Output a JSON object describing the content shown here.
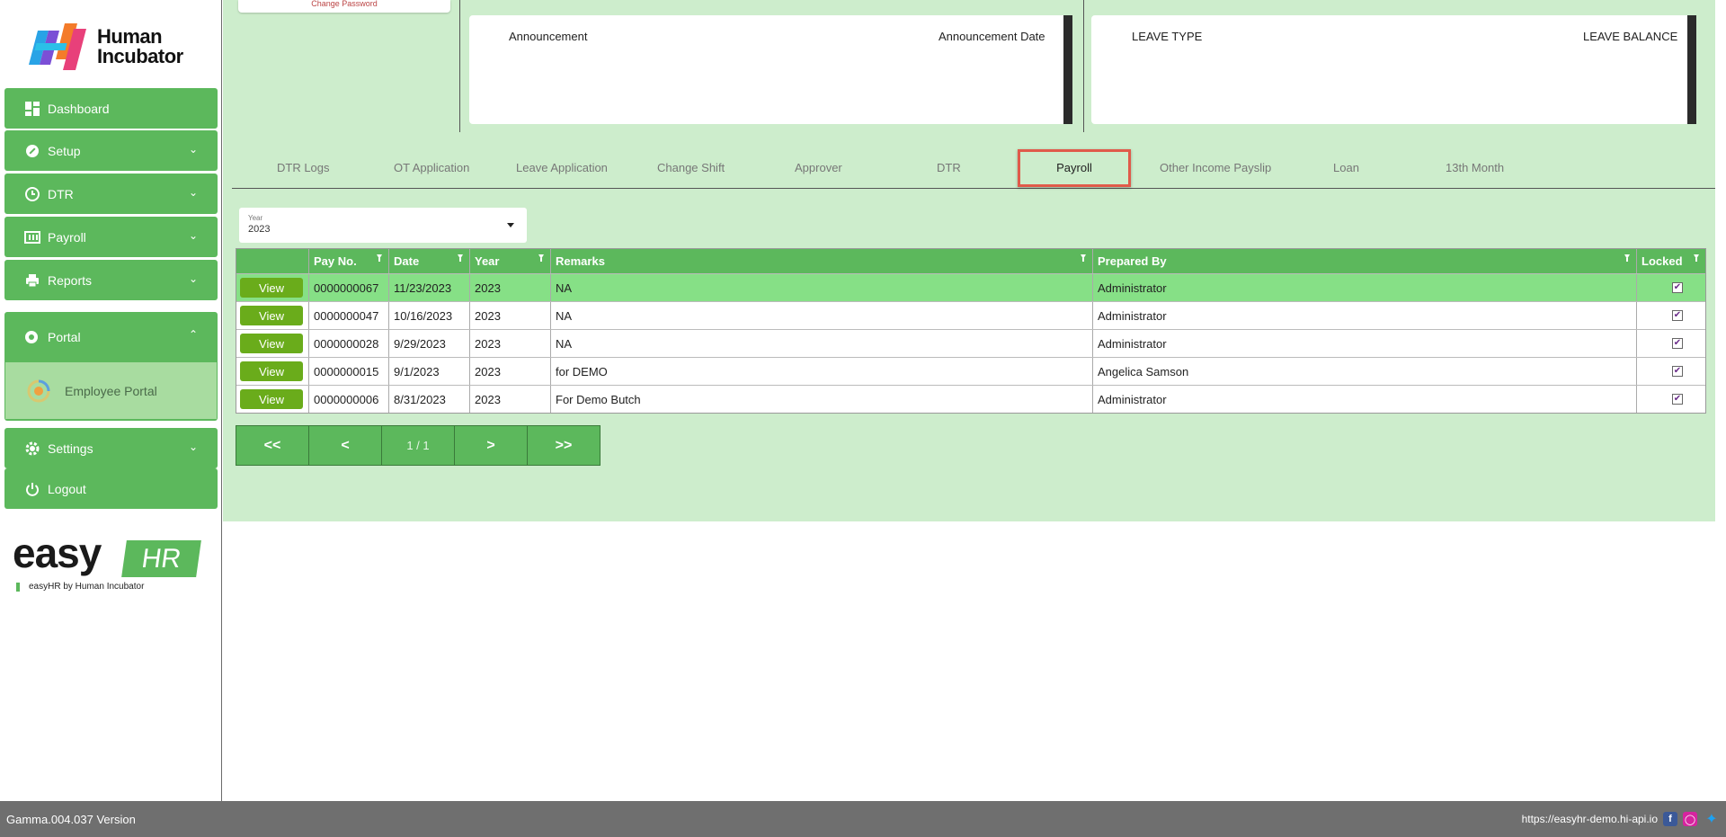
{
  "brand": {
    "logo_line1": "Human",
    "logo_line2": "Incubator",
    "easy": "easy",
    "hr": "HR",
    "tagline": "easyHR by Human Incubator"
  },
  "sidebar": {
    "items": [
      {
        "label": "Dashboard",
        "icon": "dashboard-icon"
      },
      {
        "label": "Setup",
        "icon": "wrench-icon"
      },
      {
        "label": "DTR",
        "icon": "clock-icon"
      },
      {
        "label": "Payroll",
        "icon": "payroll-icon"
      },
      {
        "label": "Reports",
        "icon": "printer-icon"
      },
      {
        "label": "Portal",
        "icon": "aperture-icon"
      },
      {
        "label": "Settings",
        "icon": "gear-icon"
      },
      {
        "label": "Logout",
        "icon": "power-icon"
      }
    ],
    "portal_sub": "Employee Portal"
  },
  "top": {
    "change_password": "Change Password",
    "announce_col1": "Announcement",
    "announce_col2": "Announcement Date",
    "leave_col1": "LEAVE TYPE",
    "leave_col2": "LEAVE BALANCE"
  },
  "tabs": [
    "DTR Logs",
    "OT Application",
    "Leave Application",
    "Change Shift",
    "Approver",
    "DTR",
    "Payroll",
    "Other Income Payslip",
    "Loan",
    "13th Month"
  ],
  "active_tab": "Payroll",
  "year_filter": {
    "label": "Year",
    "value": "2023"
  },
  "grid": {
    "headers": [
      "",
      "Pay No.",
      "Date",
      "Year",
      "Remarks",
      "Prepared By",
      "Locked"
    ],
    "view_label": "View",
    "rows": [
      {
        "pay_no": "0000000067",
        "date": "11/23/2023",
        "year": "2023",
        "remarks": "NA",
        "prepared_by": "Administrator",
        "locked": true
      },
      {
        "pay_no": "0000000047",
        "date": "10/16/2023",
        "year": "2023",
        "remarks": "NA",
        "prepared_by": "Administrator",
        "locked": true
      },
      {
        "pay_no": "0000000028",
        "date": "9/29/2023",
        "year": "2023",
        "remarks": "NA",
        "prepared_by": "Administrator",
        "locked": true
      },
      {
        "pay_no": "0000000015",
        "date": "9/1/2023",
        "year": "2023",
        "remarks": "for DEMO",
        "prepared_by": "Angelica Samson",
        "locked": true
      },
      {
        "pay_no": "0000000006",
        "date": "8/31/2023",
        "year": "2023",
        "remarks": "For Demo Butch",
        "prepared_by": "Administrator",
        "locked": true
      }
    ]
  },
  "pager": {
    "first": "<<",
    "prev": "<",
    "page": "1 / 1",
    "next": ">",
    "last": ">>"
  },
  "footer": {
    "version": "Gamma.004.037 Version",
    "url": "https://easyhr-demo.hi-api.io"
  },
  "colors": {
    "primary": "#5cb85c",
    "main_bg": "#cdedcc",
    "highlight_row": "#86e086",
    "view_btn": "#6aac1b",
    "active_tab_border": "#e05a4a",
    "footer": "#6f6f6f"
  }
}
